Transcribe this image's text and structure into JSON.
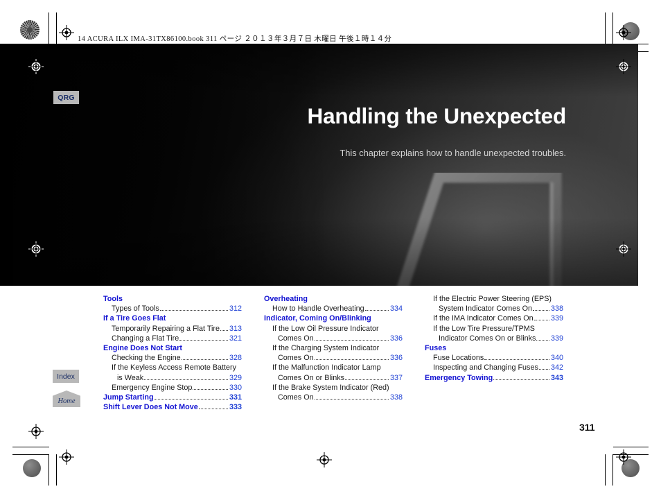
{
  "document": {
    "slug": "14 ACURA ILX IMA-31TX86100.book   311 ページ   ２０１３年３月７日   木曜日   午後１時１４分",
    "page_number": "311"
  },
  "hero": {
    "title": "Handling the Unexpected",
    "subtitle": "This chapter explains how to handle unexpected troubles.",
    "image_subject": "reflective-warning-triangle"
  },
  "tabs": {
    "qrg": "QRG",
    "index": "Index",
    "home": "Home"
  },
  "colors": {
    "heading_blue": "#1414d2",
    "page_number_blue": "#1d3fd4",
    "tab_grey": "#b8b8b8",
    "tab_text": "#1b2f66"
  },
  "toc": {
    "columns": [
      {
        "entries": [
          {
            "kind": "head",
            "label": "Tools",
            "page": "",
            "dots": false
          },
          {
            "kind": "item",
            "label": "Types of Tools",
            "page": "312",
            "dots": true
          },
          {
            "kind": "head",
            "label": "If a Tire Goes Flat",
            "page": "",
            "dots": false
          },
          {
            "kind": "item",
            "label": "Temporarily Repairing a Flat Tire",
            "page": "313",
            "dots": true
          },
          {
            "kind": "item",
            "label": "Changing a Flat Tire",
            "page": "321",
            "dots": true
          },
          {
            "kind": "head",
            "label": "Engine Does Not Start",
            "page": "",
            "dots": false
          },
          {
            "kind": "item",
            "label": "Checking the Engine",
            "page": "328",
            "dots": true
          },
          {
            "kind": "item",
            "label": "If the Keyless Access Remote Battery",
            "page": "",
            "dots": false
          },
          {
            "kind": "item2",
            "label": "is Weak",
            "page": "329",
            "dots": true
          },
          {
            "kind": "item",
            "label": "Emergency Engine Stop",
            "page": "330",
            "dots": true
          },
          {
            "kind": "head",
            "label": "Jump Starting",
            "page": "331",
            "dots": true
          },
          {
            "kind": "head",
            "label": "Shift Lever Does Not Move",
            "page": "333",
            "dots": true
          }
        ]
      },
      {
        "entries": [
          {
            "kind": "head",
            "label": "Overheating",
            "page": "",
            "dots": false
          },
          {
            "kind": "item",
            "label": "How to Handle Overheating",
            "page": "334",
            "dots": true
          },
          {
            "kind": "head",
            "label": "Indicator, Coming On/Blinking",
            "page": "",
            "dots": false
          },
          {
            "kind": "item",
            "label": "If the Low Oil Pressure Indicator",
            "page": "",
            "dots": false
          },
          {
            "kind": "item2",
            "label": "Comes  On",
            "page": "336",
            "dots": true
          },
          {
            "kind": "item",
            "label": "If the Charging System Indicator",
            "page": "",
            "dots": false
          },
          {
            "kind": "item2",
            "label": "Comes On",
            "page": "336",
            "dots": true
          },
          {
            "kind": "item",
            "label": "If the Malfunction Indicator Lamp",
            "page": "",
            "dots": false
          },
          {
            "kind": "item2",
            "label": "Comes On or Blinks",
            "page": "337",
            "dots": true
          },
          {
            "kind": "item",
            "label": "If the Brake System Indicator (Red)",
            "page": "",
            "dots": false
          },
          {
            "kind": "item2",
            "label": "Comes On",
            "page": "338",
            "dots": true
          }
        ]
      },
      {
        "entries": [
          {
            "kind": "item",
            "label": "If the Electric Power Steering (EPS)",
            "page": "",
            "dots": false
          },
          {
            "kind": "item2",
            "label": "System Indicator Comes On",
            "page": "338",
            "dots": true
          },
          {
            "kind": "item",
            "label": "If the IMA Indicator Comes On",
            "page": "339",
            "dots": true
          },
          {
            "kind": "item",
            "label": "If the Low Tire Pressure/TPMS",
            "page": "",
            "dots": false
          },
          {
            "kind": "item2",
            "label": "Indicator  Comes On or Blinks",
            "page": "339",
            "dots": true
          },
          {
            "kind": "head",
            "label": "Fuses",
            "page": "",
            "dots": false
          },
          {
            "kind": "item",
            "label": "Fuse Locations",
            "page": "340",
            "dots": true
          },
          {
            "kind": "item",
            "label": "Inspecting and Changing Fuses",
            "page": "342",
            "dots": true
          },
          {
            "kind": "head",
            "label": "Emergency Towing",
            "page": "343",
            "dots": true
          }
        ]
      }
    ]
  }
}
